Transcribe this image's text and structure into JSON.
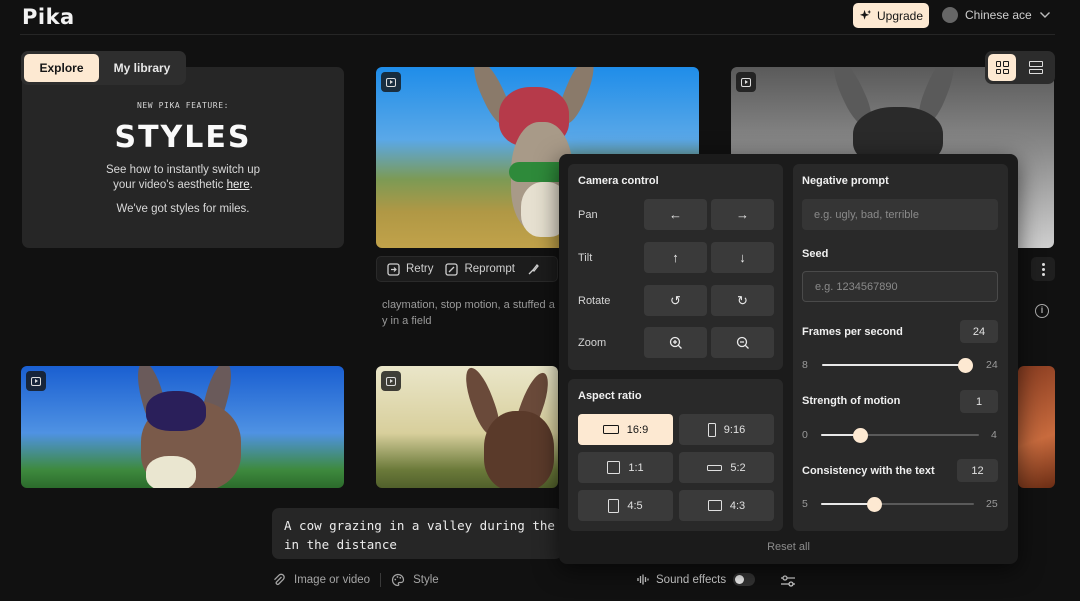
{
  "header": {
    "logo": "Pika",
    "upgrade_label": "Upgrade",
    "user_name": "Chinese ace"
  },
  "nav": {
    "tabs": [
      {
        "label": "Explore",
        "active": true
      },
      {
        "label": "My library",
        "active": false
      }
    ]
  },
  "feature_card": {
    "kicker": "NEW PIKA FEATURE:",
    "title": "STYLES",
    "body_line1": "See how to instantly switch up",
    "body_line2_prefix": "your video's aesthetic ",
    "body_link": "here",
    "body_line2_suffix": ".",
    "footer": "We've got styles for miles."
  },
  "video_actions": {
    "retry_label": "Retry",
    "reprompt_label": "Reprompt"
  },
  "video_prompt_line1": "claymation, stop motion, a stuffed a",
  "video_prompt_line2": "y in a field",
  "prompt_input": {
    "text_line1": "A cow grazing in a valley during the",
    "text_line2": "in the distance"
  },
  "bottom_tools": {
    "image_or_video": "Image or video",
    "style": "Style",
    "sound_effects": "Sound effects",
    "sound_effects_on": false
  },
  "settings": {
    "camera_control": {
      "title": "Camera control",
      "rows": [
        {
          "label": "Pan",
          "buttons": [
            "←",
            "→"
          ]
        },
        {
          "label": "Tilt",
          "buttons": [
            "↑",
            "↓"
          ]
        },
        {
          "label": "Rotate",
          "buttons": [
            "↺",
            "↻"
          ]
        },
        {
          "label": "Zoom",
          "buttons": [
            "zoom-in",
            "zoom-out"
          ]
        }
      ]
    },
    "aspect_ratio": {
      "title": "Aspect ratio",
      "options": [
        "16:9",
        "9:16",
        "1:1",
        "5:2",
        "4:5",
        "4:3"
      ],
      "selected": "16:9"
    },
    "negative_prompt": {
      "title": "Negative prompt",
      "placeholder": "e.g. ugly, bad, terrible"
    },
    "seed": {
      "title": "Seed",
      "placeholder": "e.g. 1234567890"
    },
    "fps": {
      "title": "Frames per second",
      "value": "24",
      "min": "8",
      "max": "24",
      "fraction": 1.0
    },
    "motion": {
      "title": "Strength of motion",
      "value": "1",
      "min": "0",
      "max": "4",
      "fraction": 0.25
    },
    "consistency": {
      "title": "Consistency with the text",
      "value": "12",
      "min": "5",
      "max": "25",
      "fraction": 0.35
    },
    "reset_label": "Reset all"
  },
  "colors": {
    "accent": "#fde9d2",
    "background": "#111111",
    "panel": "#1b1b1b",
    "section": "#292929"
  }
}
